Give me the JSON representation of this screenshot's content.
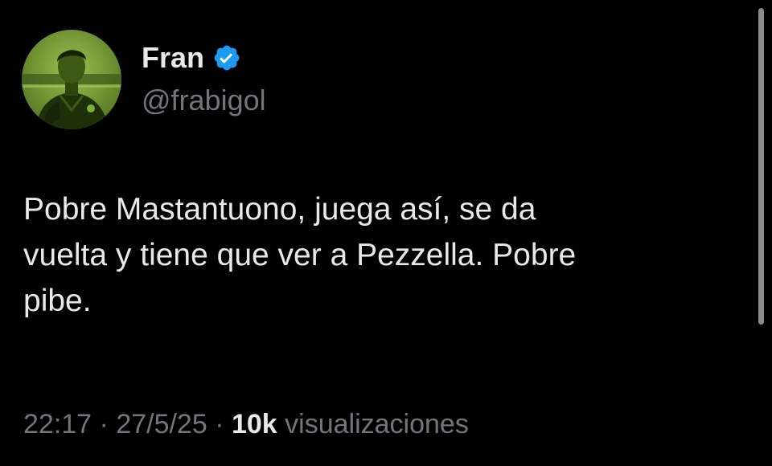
{
  "author": {
    "display_name": "Fran",
    "handle": "@frabigol",
    "verified": true,
    "avatar_icon": "profile-photo-green-tint",
    "verified_icon": "verified-badge-icon"
  },
  "tweet": {
    "text": "Pobre Mastantuono, juega así, se da\nvuelta y tiene que ver a Pezzella. Pobre\npibe."
  },
  "meta": {
    "time": "22:17",
    "separator": " · ",
    "date": "27/5/25",
    "views_count": "10k",
    "views_label": " visualizaciones"
  },
  "colors": {
    "background": "#000000",
    "primary_text": "#e7e9ea",
    "secondary_text": "#71767b",
    "verified_blue": "#1d9bf0",
    "avatar_tint": "#7fae3a"
  }
}
